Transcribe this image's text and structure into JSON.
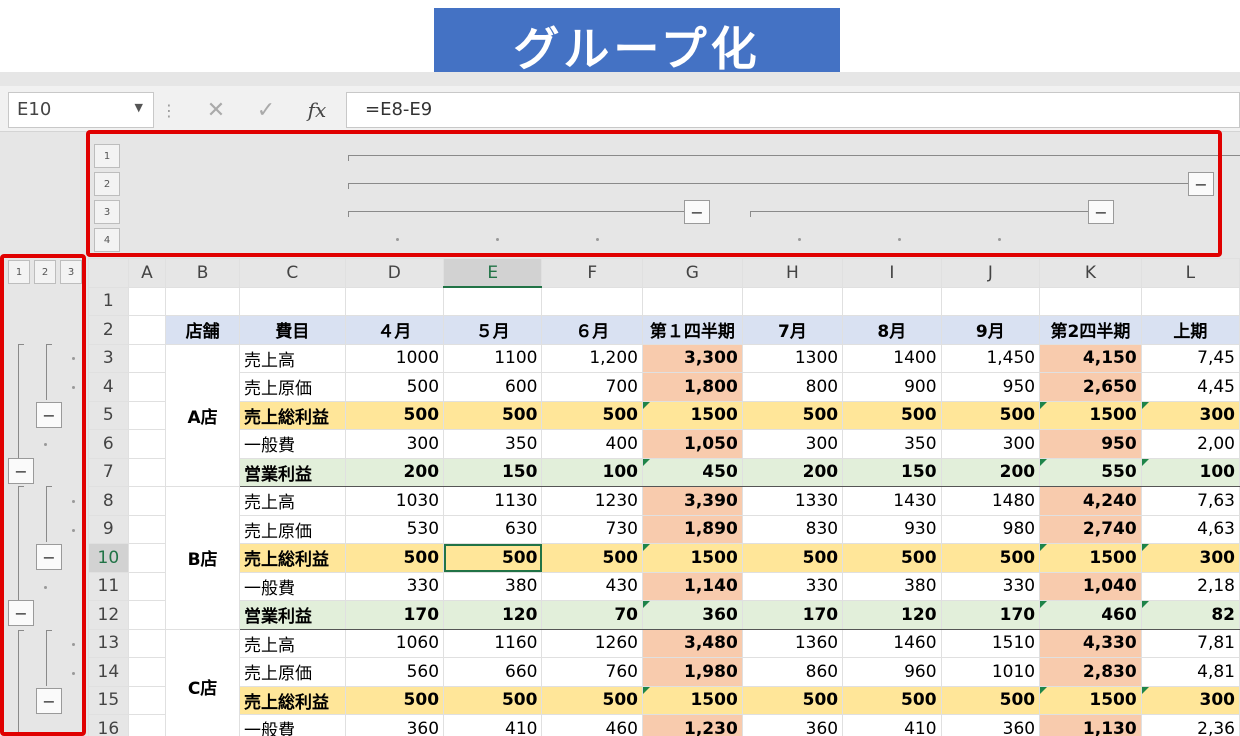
{
  "banner": {
    "title": "グループ化"
  },
  "formula_bar": {
    "name_box": "E10",
    "cancel_icon": "✕",
    "enter_icon": "✓",
    "fx_label": "fx",
    "formula": "=E8-E9"
  },
  "outline_levels": {
    "columns": [
      "1",
      "2",
      "3",
      "4"
    ],
    "rows": [
      "1",
      "2",
      "3"
    ],
    "collapse_symbol": "−"
  },
  "columns": [
    "A",
    "B",
    "C",
    "D",
    "E",
    "F",
    "G",
    "H",
    "I",
    "J",
    "K",
    "L"
  ],
  "selected_column": "E",
  "selected_row": "10",
  "header_row": {
    "row": "2",
    "cells": [
      "店舗",
      "費目",
      "４月",
      "５月",
      "６月",
      "第１四半期",
      "7月",
      "8月",
      "9月",
      "第2四半期",
      "上期"
    ]
  },
  "stores": [
    {
      "name": "A店",
      "rows": [
        {
          "row": "3",
          "label": "売上高",
          "values": [
            "1000",
            "1100",
            "1,200",
            "3,300",
            "1300",
            "1400",
            "1,450",
            "4,150",
            "7,45"
          ]
        },
        {
          "row": "4",
          "label": "売上原価",
          "values": [
            "500",
            "600",
            "700",
            "1,800",
            "800",
            "900",
            "950",
            "2,650",
            "4,45"
          ]
        },
        {
          "row": "5",
          "label": "売上総利益",
          "values": [
            "500",
            "500",
            "500",
            "1500",
            "500",
            "500",
            "500",
            "1500",
            "300"
          ]
        },
        {
          "row": "6",
          "label": "一般費",
          "values": [
            "300",
            "350",
            "400",
            "1,050",
            "300",
            "350",
            "300",
            "950",
            "2,00"
          ]
        },
        {
          "row": "7",
          "label": "営業利益",
          "values": [
            "200",
            "150",
            "100",
            "450",
            "200",
            "150",
            "200",
            "550",
            "100"
          ]
        }
      ]
    },
    {
      "name": "B店",
      "rows": [
        {
          "row": "8",
          "label": "売上高",
          "values": [
            "1030",
            "1130",
            "1230",
            "3,390",
            "1330",
            "1430",
            "1480",
            "4,240",
            "7,63"
          ]
        },
        {
          "row": "9",
          "label": "売上原価",
          "values": [
            "530",
            "630",
            "730",
            "1,890",
            "830",
            "930",
            "980",
            "2,740",
            "4,63"
          ]
        },
        {
          "row": "10",
          "label": "売上総利益",
          "values": [
            "500",
            "500",
            "500",
            "1500",
            "500",
            "500",
            "500",
            "1500",
            "300"
          ]
        },
        {
          "row": "11",
          "label": "一般費",
          "values": [
            "330",
            "380",
            "430",
            "1,140",
            "330",
            "380",
            "330",
            "1,040",
            "2,18"
          ]
        },
        {
          "row": "12",
          "label": "営業利益",
          "values": [
            "170",
            "120",
            "70",
            "360",
            "170",
            "120",
            "170",
            "460",
            "82"
          ]
        }
      ]
    },
    {
      "name": "C店",
      "rows": [
        {
          "row": "13",
          "label": "売上高",
          "values": [
            "1060",
            "1160",
            "1260",
            "3,480",
            "1360",
            "1460",
            "1510",
            "4,330",
            "7,81"
          ]
        },
        {
          "row": "14",
          "label": "売上原価",
          "values": [
            "560",
            "660",
            "760",
            "1,980",
            "860",
            "960",
            "1010",
            "2,830",
            "4,81"
          ]
        },
        {
          "row": "15",
          "label": "売上総利益",
          "values": [
            "500",
            "500",
            "500",
            "1500",
            "500",
            "500",
            "500",
            "1500",
            "300"
          ]
        },
        {
          "row": "16",
          "label": "一般費",
          "values": [
            "360",
            "410",
            "460",
            "1,230",
            "360",
            "410",
            "360",
            "1,130",
            "2,36"
          ]
        }
      ]
    }
  ],
  "colors": {
    "banner": "#4472c4",
    "highlight_box": "#e00000",
    "header_fill": "#d9e1f2",
    "quarter_fill": "#f8cbad",
    "gross_fill": "#ffe699",
    "op_fill": "#e2efda",
    "selection": "#217346"
  }
}
